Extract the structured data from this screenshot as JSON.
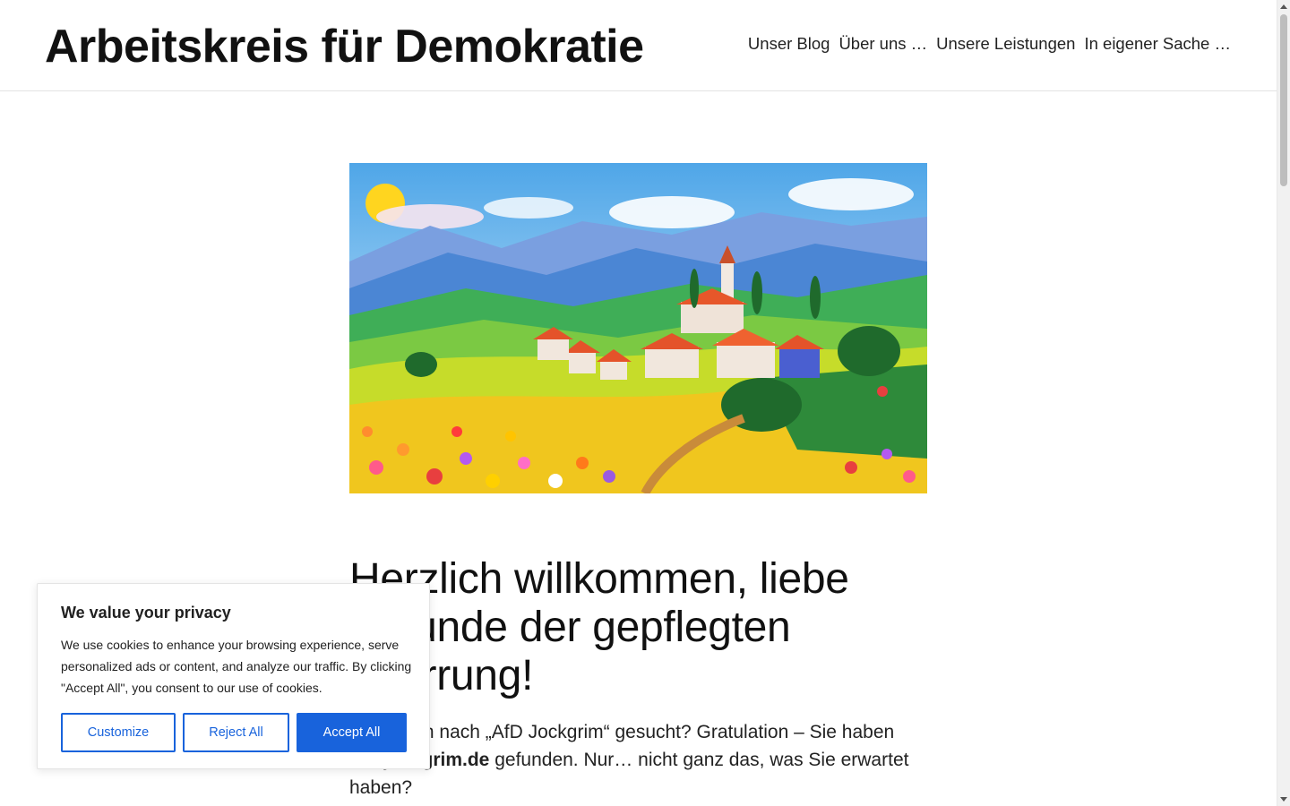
{
  "header": {
    "site_title": "Arbeitskreis für Demokratie",
    "nav": [
      {
        "label": "Unser Blog"
      },
      {
        "label": "Über uns …"
      },
      {
        "label": "Unsere Leistungen"
      },
      {
        "label": "In eigener Sache …"
      }
    ]
  },
  "hero_image": {
    "icon": "village-landscape-illustration"
  },
  "article": {
    "headline": "Herzlich willkommen, liebe Freunde der gepflegten Verirrung!",
    "intro_prefix": "Sie haben nach „AfD Jockgrim“ gesucht? Gratulation – Sie haben ",
    "intro_domain": "afd-jockgrim.de",
    "intro_suffix": " gefunden. Nur… nicht ganz das, was Sie erwartet haben?"
  },
  "cookie_banner": {
    "title": "We value your privacy",
    "text": "We use cookies to enhance your browsing experience, serve personalized ads or content, and analyze our traffic. By clicking \"Accept All\", you consent to our use of cookies.",
    "customize_label": "Customize",
    "reject_label": "Reject All",
    "accept_label": "Accept All",
    "accent_color": "#1863dc"
  }
}
